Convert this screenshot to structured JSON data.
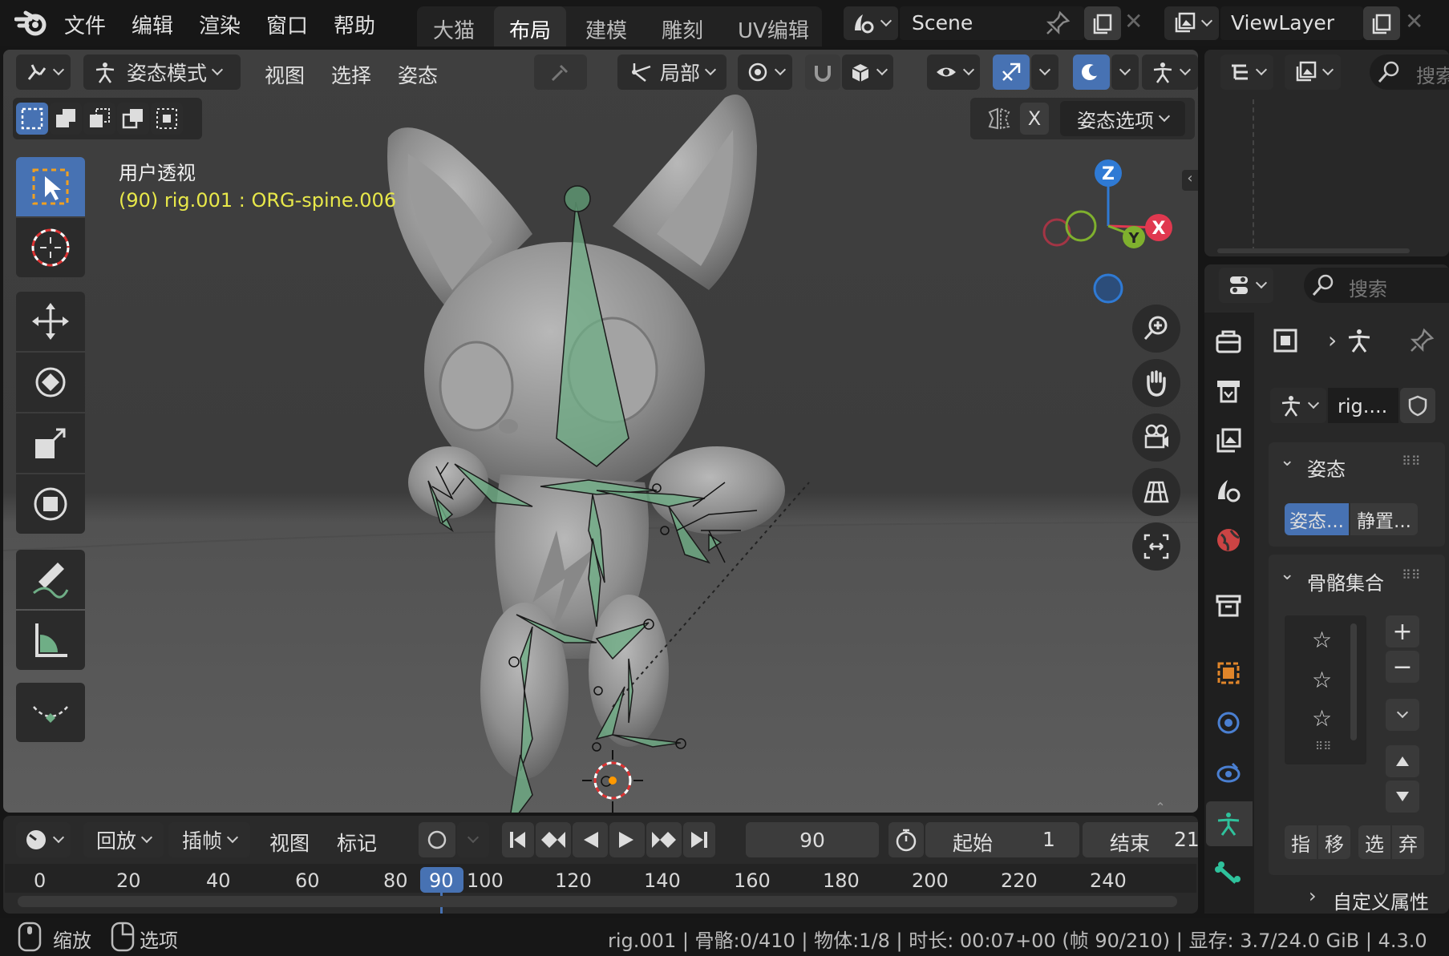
{
  "topbar": {
    "menus": [
      "文件",
      "编辑",
      "渲染",
      "窗口",
      "帮助"
    ],
    "workspaces": [
      "大猫",
      "布局",
      "建模",
      "雕刻",
      "UV编辑"
    ],
    "active_workspace": "布局",
    "scene": "Scene",
    "view_layer": "ViewLayer"
  },
  "viewport_header": {
    "mode": "姿态模式",
    "menus": [
      "视图",
      "选择",
      "姿态"
    ],
    "transform_orientation": "局部",
    "pose_options": "姿态选项",
    "mirror_axis": "X"
  },
  "overlay": {
    "view_name": "用户透视",
    "object_info": "(90) rig.001 : ORG-spine.006"
  },
  "gizmo": {
    "z": "Z",
    "x": "X",
    "y": "Y"
  },
  "outliner": {
    "search_placeholder": "搜索"
  },
  "properties": {
    "search_placeholder": "搜索",
    "object_name": "rig....",
    "pose_panel_title": "姿态",
    "pose_btn": "姿态...",
    "rest_btn": "静置...",
    "bone_collections_title": "骨骼集合",
    "buttons": [
      "指",
      "移",
      "选",
      "弃"
    ],
    "custom_props": "自定义属性"
  },
  "timeline": {
    "menus": [
      "回放",
      "插帧",
      "视图",
      "标记"
    ],
    "current_frame": "90",
    "start_label": "起始",
    "start_value": "1",
    "end_label": "结束",
    "end_value": "21",
    "ticks": [
      "0",
      "20",
      "40",
      "60",
      "80",
      "90",
      "100",
      "120",
      "140",
      "160",
      "180",
      "200",
      "220",
      "240"
    ]
  },
  "statusbar": {
    "zoom": "缩放",
    "options": "选项",
    "info": "rig.001 | 骨骼:0/410 | 物体:1/8 | 时长: 00:07+00 (帧 90/210) | 显存: 3.7/24.0 GiB | 4.3.0"
  },
  "colors": {
    "accent": "#4772b3",
    "bone": "#6fae86",
    "yellow": "#e8e84a",
    "x_axis": "#e0384f",
    "z_axis": "#2f7ad4",
    "y_axis": "#7fb02e"
  }
}
